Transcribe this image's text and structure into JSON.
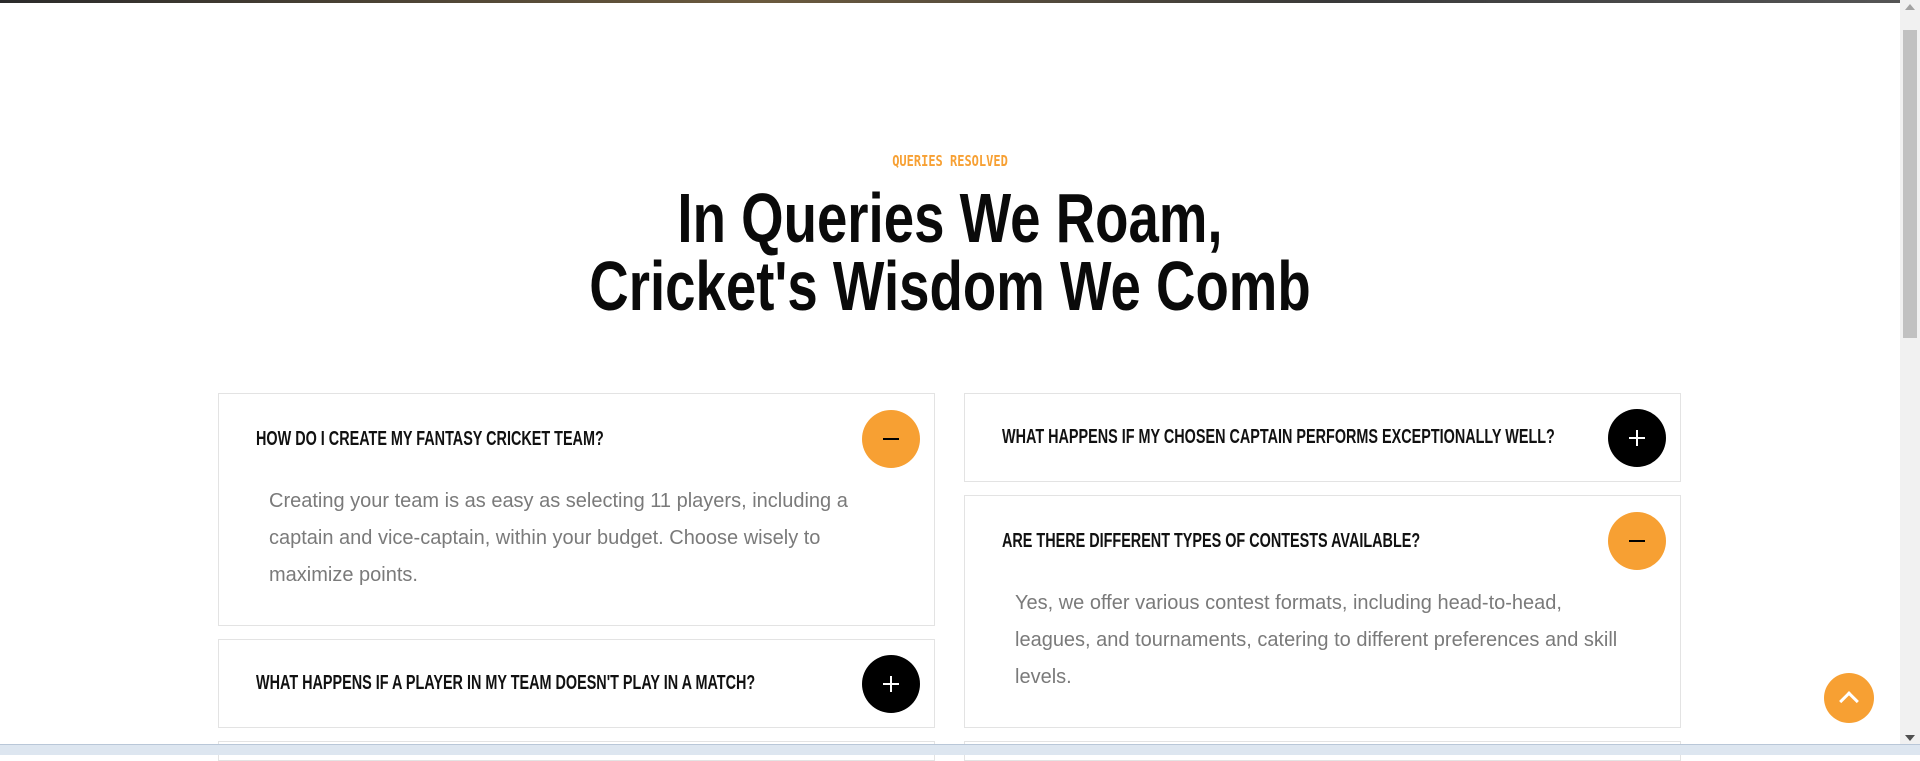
{
  "section": {
    "eyebrow": "QUERIES RESOLVED",
    "heading_line1": "In Queries We Roam,",
    "heading_line2": "Cricket's Wisdom We Comb"
  },
  "faqs": [
    {
      "question": "HOW DO I CREATE MY FANTASY CRICKET TEAM?",
      "answer": "Creating your team is as easy as selecting 11 players, including a captain and vice-captain, within your budget. Choose wisely to maximize points.",
      "state": "expanded"
    },
    {
      "question": "WHAT HAPPENS IF A PLAYER IN MY TEAM DOESN'T PLAY IN A MATCH?",
      "state": "collapsed"
    },
    {
      "question": "WHAT HAPPENS IF MY CHOSEN CAPTAIN PERFORMS EXCEPTIONALLY WELL?",
      "state": "collapsed"
    },
    {
      "question": "ARE THERE DIFFERENT TYPES OF CONTESTS AVAILABLE?",
      "answer": "Yes, we offer various contest formats, including head-to-head, leagues, and tournaments, catering to different preferences and skill levels.",
      "state": "expanded"
    }
  ],
  "icons": {
    "expanded_toggle": "minus-icon",
    "collapsed_toggle": "plus-icon",
    "back_to_top": "chevron-up-icon"
  },
  "colors": {
    "accent": "#f7a033",
    "heading": "#0a0a0a",
    "answer_text": "#7a7a7a",
    "collapsed_toggle_bg": "#000000"
  }
}
